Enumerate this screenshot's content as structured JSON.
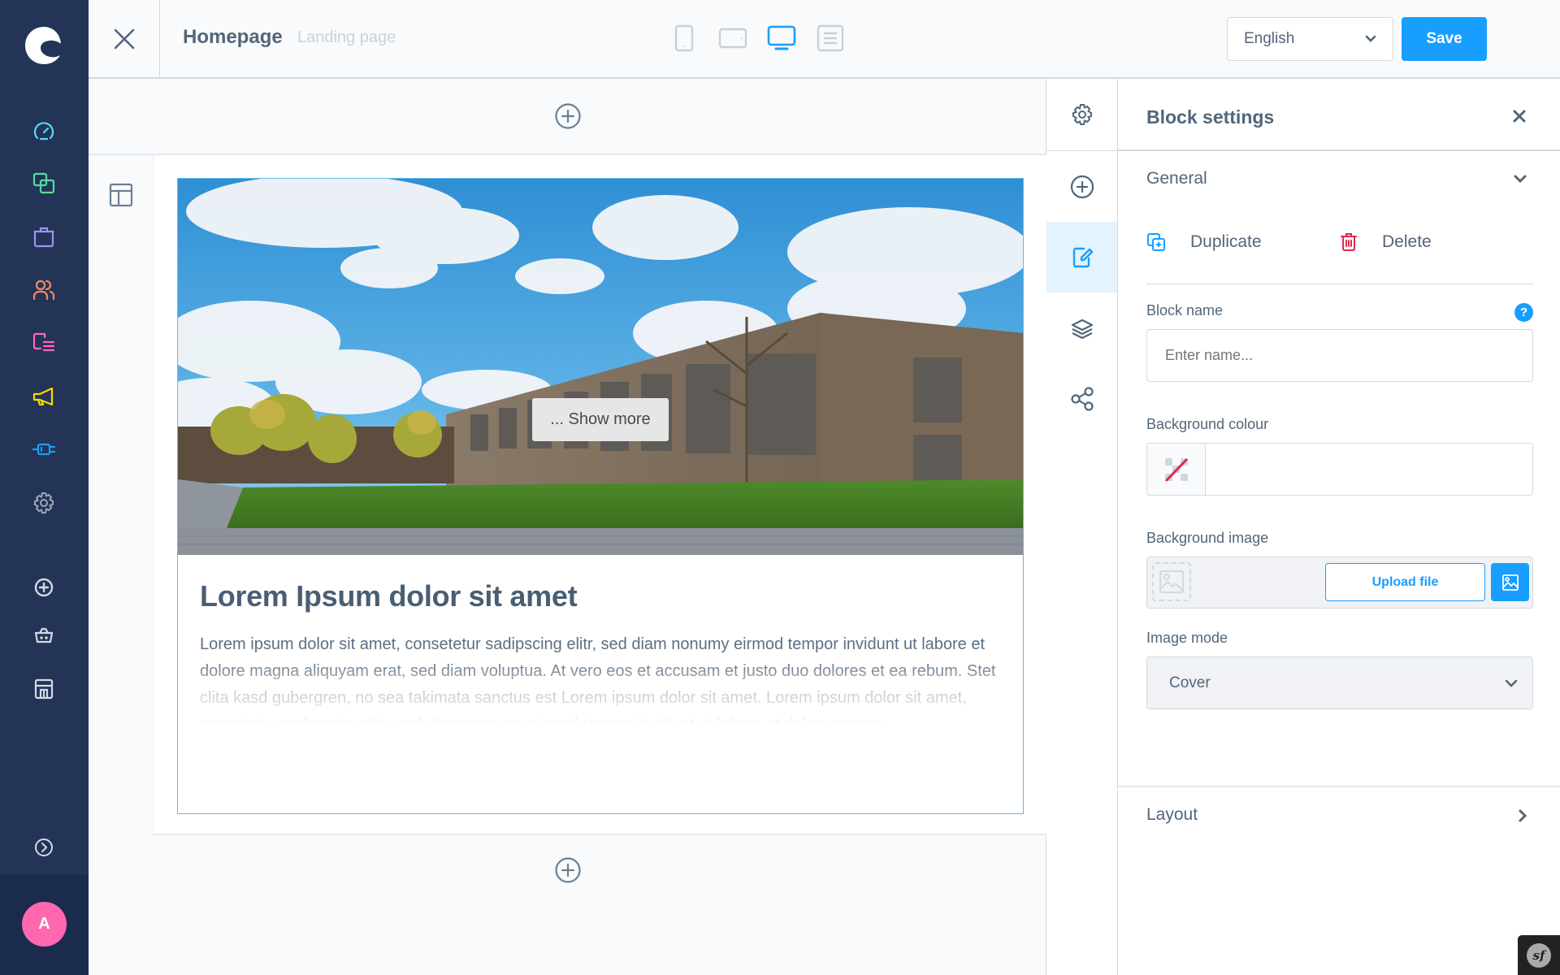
{
  "admin_nav": {
    "logo": "shopware-logo",
    "items": [
      {
        "name": "dashboard",
        "icon": "gauge-icon",
        "color": "#57d9f9"
      },
      {
        "name": "catalogues",
        "icon": "products-icon",
        "color": "#57d9a3"
      },
      {
        "name": "orders",
        "icon": "shopping-bag-icon",
        "color": "#a092f0"
      },
      {
        "name": "customers",
        "icon": "users-icon",
        "color": "#f88962"
      },
      {
        "name": "content",
        "icon": "content-icon",
        "color": "#ff68b4"
      },
      {
        "name": "marketing",
        "icon": "megaphone-icon",
        "color": "#ffd700"
      },
      {
        "name": "extensions",
        "icon": "plug-icon",
        "color": "#189eff"
      },
      {
        "name": "settings",
        "icon": "gear-icon",
        "color": "#9aa8b5"
      }
    ],
    "sales_channels": [
      {
        "name": "add-sales-channel",
        "icon": "plus-circle-icon"
      },
      {
        "name": "storefront-basket",
        "icon": "basket-icon"
      },
      {
        "name": "storefront-shop",
        "icon": "storefront-icon"
      }
    ],
    "expand_icon": "chevron-right-circle-icon",
    "user_initial": "A",
    "avatar_color": "#ff68ae"
  },
  "topbar": {
    "title": "Homepage",
    "subtitle": "Landing page",
    "devices": [
      {
        "name": "mobile",
        "active": false
      },
      {
        "name": "tablet",
        "active": false
      },
      {
        "name": "desktop",
        "active": true
      },
      {
        "name": "form",
        "active": false
      }
    ],
    "language": "English",
    "save_label": "Save"
  },
  "block": {
    "heading": "Lorem Ipsum dolor sit amet",
    "text": "Lorem ipsum dolor sit amet, consetetur sadipscing elitr, sed diam nonumy eirmod tempor invidunt ut labore et dolore magna aliquyam erat, sed diam voluptua. At vero eos et accusam et justo duo dolores et ea rebum. Stet clita kasd gubergren, no sea takimata sanctus est Lorem ipsum dolor sit amet. Lorem ipsum dolor sit amet, consetetur sadipscing elitr, sed diam nonumy eirmod tempor invidunt ut labore et dolore magna",
    "show_more_label": "... Show more",
    "image_alt": "Modern wooden building with lawn and trees under blue sky"
  },
  "tools": [
    {
      "name": "page-settings",
      "icon": "gear-icon",
      "active": false
    },
    {
      "name": "add-block",
      "icon": "plus-circle-icon",
      "active": false
    },
    {
      "name": "block-settings",
      "icon": "edit-icon",
      "active": true
    },
    {
      "name": "layers",
      "icon": "layers-icon",
      "active": false
    },
    {
      "name": "share",
      "icon": "share-icon",
      "active": false
    }
  ],
  "panel": {
    "title": "Block settings",
    "general_label": "General",
    "duplicate_label": "Duplicate",
    "delete_label": "Delete",
    "block_name_label": "Block name",
    "block_name_placeholder": "Enter name...",
    "block_name_value": "",
    "bg_colour_label": "Background colour",
    "bg_colour_value": "",
    "bg_image_label": "Background image",
    "upload_label": "Upload file",
    "image_mode_label": "Image mode",
    "image_mode_value": "Cover",
    "layout_label": "Layout"
  },
  "colors": {
    "accent": "#189eff",
    "danger": "#de294c",
    "sidebar_bg": "#233457",
    "text": "#52667a"
  }
}
